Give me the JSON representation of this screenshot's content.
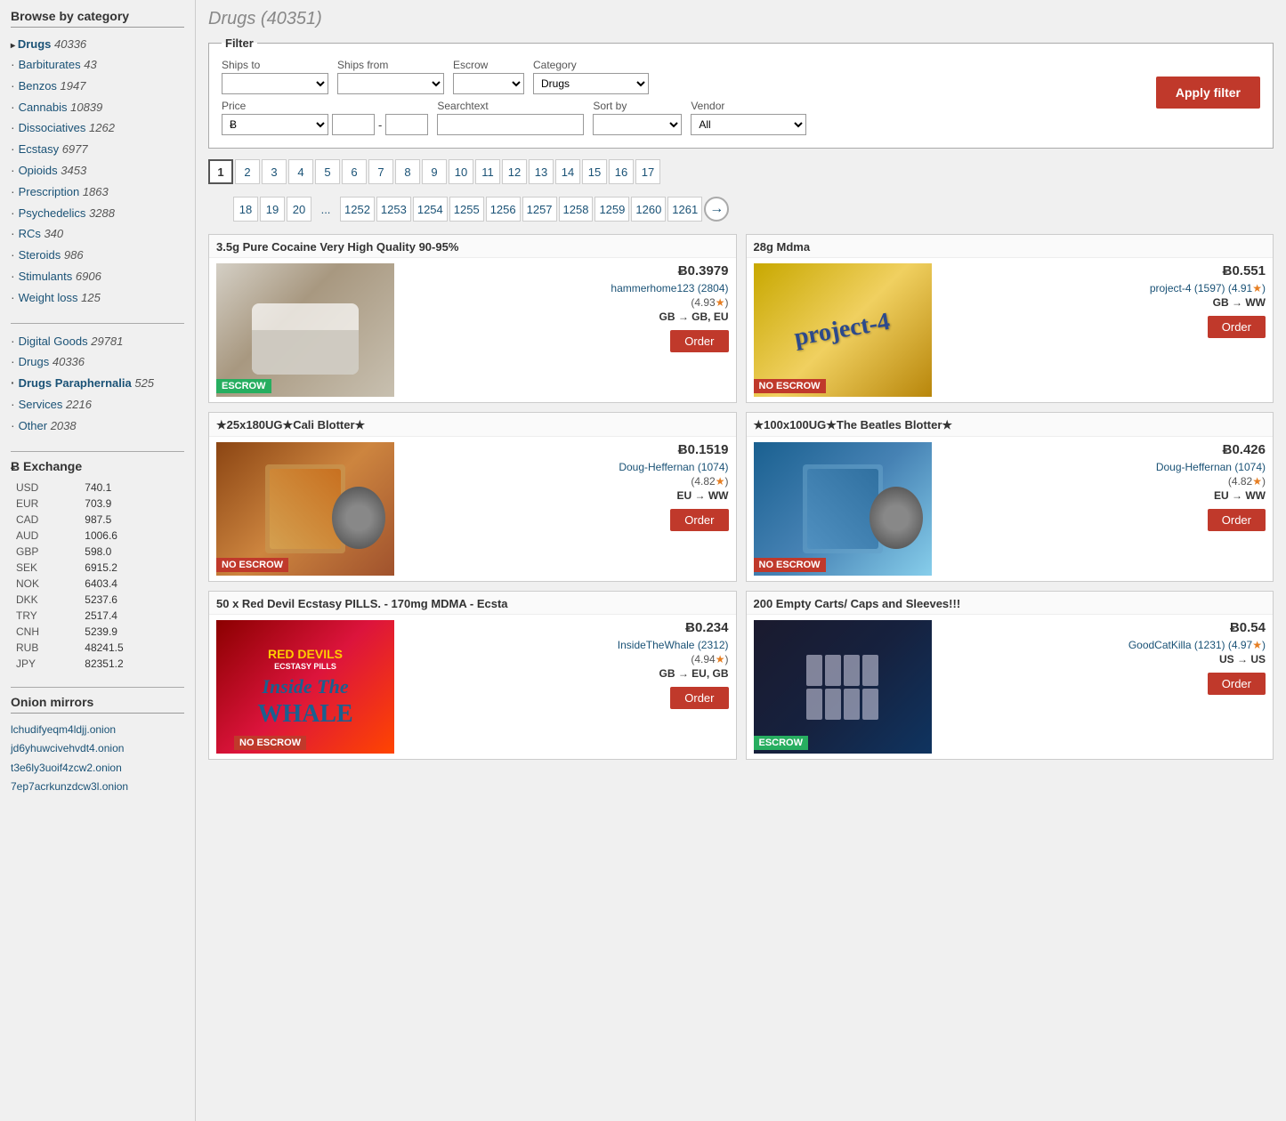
{
  "sidebar": {
    "browse_title": "Browse by category",
    "categories": [
      {
        "name": "Drugs",
        "count": "40336",
        "active": true,
        "bullet": "arrow"
      },
      {
        "name": "Barbiturates",
        "count": "43",
        "active": false
      },
      {
        "name": "Benzos",
        "count": "1947",
        "active": false
      },
      {
        "name": "Cannabis",
        "count": "10839",
        "active": false
      },
      {
        "name": "Dissociatives",
        "count": "1262",
        "active": false
      },
      {
        "name": "Ecstasy",
        "count": "6977",
        "active": false
      },
      {
        "name": "Opioids",
        "count": "3453",
        "active": false
      },
      {
        "name": "Prescription",
        "count": "1863",
        "active": false
      },
      {
        "name": "Psychedelics",
        "count": "3288",
        "active": false
      },
      {
        "name": "RCs",
        "count": "340",
        "active": false
      },
      {
        "name": "Steroids",
        "count": "986",
        "active": false
      },
      {
        "name": "Stimulants",
        "count": "6906",
        "active": false
      },
      {
        "name": "Weight loss",
        "count": "125",
        "active": false
      }
    ],
    "top_categories": [
      {
        "name": "Digital Goods",
        "count": "29781"
      },
      {
        "name": "Drugs",
        "count": "40336"
      },
      {
        "name": "Drugs Paraphernalia",
        "count": "525"
      },
      {
        "name": "Services",
        "count": "2216"
      },
      {
        "name": "Other",
        "count": "2038"
      }
    ],
    "exchange_title": "Ƀ Exchange",
    "exchange_rates": [
      {
        "currency": "USD",
        "rate": "740.1"
      },
      {
        "currency": "EUR",
        "rate": "703.9"
      },
      {
        "currency": "CAD",
        "rate": "987.5"
      },
      {
        "currency": "AUD",
        "rate": "1006.6"
      },
      {
        "currency": "GBP",
        "rate": "598.0"
      },
      {
        "currency": "SEK",
        "rate": "6915.2"
      },
      {
        "currency": "NOK",
        "rate": "6403.4"
      },
      {
        "currency": "DKK",
        "rate": "5237.6"
      },
      {
        "currency": "TRY",
        "rate": "2517.4"
      },
      {
        "currency": "CNH",
        "rate": "5239.9"
      },
      {
        "currency": "RUB",
        "rate": "48241.5"
      },
      {
        "currency": "JPY",
        "rate": "82351.2"
      }
    ],
    "onion_title": "Onion mirrors",
    "onion_links": [
      "lchudifyeqm4ldjj.onion",
      "jd6yhuwcivehvdt4.onion",
      "t3e6ly3uoif4zcw2.onion",
      "7ep7acrkunzdcw3l.onion"
    ]
  },
  "main": {
    "page_title": "Drugs (40351)",
    "filter": {
      "legend": "Filter",
      "ships_to_label": "Ships to",
      "ships_from_label": "Ships from",
      "escrow_label": "Escrow",
      "category_label": "Category",
      "category_value": "Drugs",
      "price_label": "Price",
      "searchtext_label": "Searchtext",
      "sort_by_label": "Sort by",
      "vendor_label": "Vendor",
      "vendor_value": "All",
      "apply_label": "Apply filter",
      "price_currency": "Ƀ"
    },
    "pagination_row1": [
      "1",
      "2",
      "3",
      "4",
      "5",
      "6",
      "7",
      "8",
      "9",
      "10",
      "11",
      "12",
      "13",
      "14",
      "15",
      "16",
      "17"
    ],
    "pagination_row2": [
      "18",
      "19",
      "20",
      "...",
      "1252",
      "1253",
      "1254",
      "1255",
      "1256",
      "1257",
      "1258",
      "1259",
      "1260",
      "1261"
    ],
    "products": [
      {
        "id": 1,
        "title": "3.5g Pure Cocaine Very High Quality 90-95%",
        "price": "Ƀ0.3979",
        "vendor": "hammerhome123 (2804)",
        "rating": "(4.93★)",
        "shipping": "GB → GB, EU",
        "escrow": "ESCROW",
        "escrow_type": "green",
        "img_class": "img-cocaine"
      },
      {
        "id": 2,
        "title": "28g Mdma",
        "price": "Ƀ0.551",
        "vendor": "project-4 (1597) (4.91★)",
        "rating": "",
        "shipping": "GB → WW",
        "escrow": "NO ESCROW",
        "escrow_type": "red",
        "img_class": "img-mdma"
      },
      {
        "id": 3,
        "title": "★25x180UG★Cali Blotter★",
        "price": "Ƀ0.1519",
        "vendor": "Doug-Heffernan (1074)",
        "rating": "(4.82★)",
        "shipping": "EU → WW",
        "escrow": "NO ESCROW",
        "escrow_type": "red",
        "img_class": "img-blotter1"
      },
      {
        "id": 4,
        "title": "★100x100UG★The Beatles Blotter★",
        "price": "Ƀ0.426",
        "vendor": "Doug-Heffernan (1074)",
        "rating": "(4.82★)",
        "shipping": "EU → WW",
        "escrow": "NO ESCROW",
        "escrow_type": "red",
        "img_class": "img-blotter2"
      },
      {
        "id": 5,
        "title": "50 x Red Devil Ecstasy PILLS. - 170mg MDMA - Ecsta",
        "price": "Ƀ0.234",
        "vendor": "InsideTheWhale (2312)",
        "rating": "(4.94★)",
        "shipping": "GB → EU, GB",
        "escrow": "NO ESCROW",
        "escrow_type": "red",
        "img_class": "img-ecstasy"
      },
      {
        "id": 6,
        "title": "200 Empty Carts/ Caps and Sleeves!!!",
        "price": "Ƀ0.54",
        "vendor": "GoodCatKilla (1231) (4.97★)",
        "rating": "",
        "shipping": "US → US",
        "escrow": "ESCROW",
        "escrow_type": "green",
        "img_class": "img-carts"
      }
    ],
    "order_label": "Order"
  }
}
